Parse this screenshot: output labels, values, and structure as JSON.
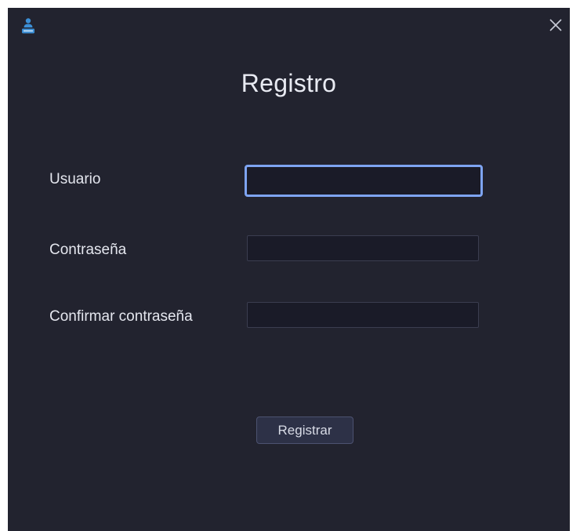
{
  "window": {
    "close_icon": "close-icon",
    "app_icon": "user-id-badge-icon"
  },
  "form": {
    "title": "Registro",
    "fields": [
      {
        "label": "Usuario",
        "value": ""
      },
      {
        "label": "Contraseña",
        "value": ""
      },
      {
        "label": "Confirmar contraseña",
        "value": ""
      }
    ],
    "submit_label": "Registrar"
  },
  "colors": {
    "background": "#22232f",
    "input_background": "#1a1b28",
    "focus_border": "#7ea4f2",
    "button_background": "#2d3147"
  }
}
